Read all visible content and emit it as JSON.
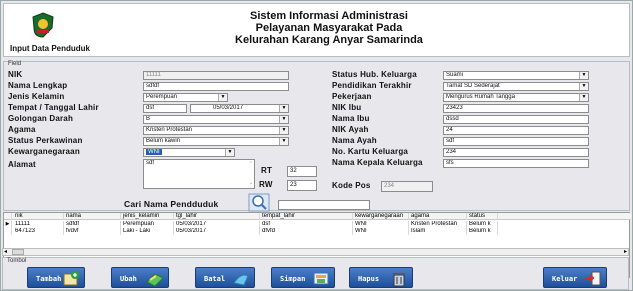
{
  "header": {
    "left_title": "Input Data Penduduk",
    "title_line1": "Sistem Informasi Administrasi",
    "title_line2": "Pelayanan Masyarakat Pada",
    "title_line3": "Kelurahan Karang Anyar Samarinda"
  },
  "field_legend": "Field",
  "form": {
    "nik": {
      "label": "NIK",
      "value": "11111"
    },
    "nama": {
      "label": "Nama Lengkap",
      "value": "sdfdf"
    },
    "jk": {
      "label": "Jenis Kelamin",
      "value": "Perempuan"
    },
    "ttl": {
      "label": "Tempat / Tanggal Lahir",
      "tempat": "dsf",
      "tanggal": "05/03/2017"
    },
    "goldar": {
      "label": "Golongan Darah",
      "value": "B"
    },
    "agama": {
      "label": "Agama",
      "value": "Kristen Protestan"
    },
    "kawin": {
      "label": "Status Perkawinan",
      "value": "Belum kawin"
    },
    "warga": {
      "label": "Kewarganegaraan",
      "value": "WNI"
    },
    "alamat": {
      "label": "Alamat",
      "value": "sdf"
    },
    "rt": {
      "label": "RT",
      "value": "32"
    },
    "rw": {
      "label": "RW",
      "value": "23"
    },
    "hub": {
      "label": "Status Hub. Keluarga",
      "value": "Suami"
    },
    "pend": {
      "label": "Pendidikan Terakhir",
      "value": "Tamat SD Sederajat"
    },
    "kerja": {
      "label": "Pekerjaan",
      "value": "Mengurus Rumah Tangga"
    },
    "nikibu": {
      "label": "NIK Ibu",
      "value": "23423"
    },
    "namaibu": {
      "label": "Nama Ibu",
      "value": "dssd"
    },
    "nikayah": {
      "label": "NIK Ayah",
      "value": "24"
    },
    "namaayah": {
      "label": "Nama Ayah",
      "value": "sdf"
    },
    "kk": {
      "label": "No. Kartu Keluarga",
      "value": "234"
    },
    "kepala": {
      "label": "Nama Kepala Keluarga",
      "value": "sfs"
    },
    "kodepos": {
      "label": "Kode Pos",
      "value": "234"
    }
  },
  "search": {
    "label": "Cari Nama Pendduduk",
    "value": ""
  },
  "grid": {
    "columns": [
      "nik",
      "nama",
      "jenis_kelamin",
      "tgl_lahir",
      "tempat_lahir",
      "kewarganegaraan",
      "agama",
      "status"
    ],
    "rows": [
      [
        "11111",
        "sdfdf",
        "Perempuan",
        "05/03/2017",
        "dsf",
        "WNI",
        "Kristen Protestan",
        "Belum k"
      ],
      [
        "647123",
        "fvdvf",
        "Laki - Laki",
        "05/03/2017",
        "dfvfd",
        "WNI",
        "Islam",
        "Belum k"
      ]
    ]
  },
  "tombol_label": "Tombol",
  "buttons": {
    "tambah": "Tambah",
    "ubah": "Ubah",
    "batal": "Batal",
    "simpan": "Simpan",
    "hapus": "Hapus",
    "keluar": "Keluar"
  },
  "colors": {
    "button": "#2b5fae",
    "selection": "#2a5db0"
  },
  "icons": {
    "logo": "emblem-icon",
    "search": "search-icon",
    "tambah": "add-icon",
    "ubah": "edit-icon",
    "batal": "cancel-icon",
    "simpan": "save-icon",
    "hapus": "delete-icon",
    "keluar": "exit-icon"
  }
}
